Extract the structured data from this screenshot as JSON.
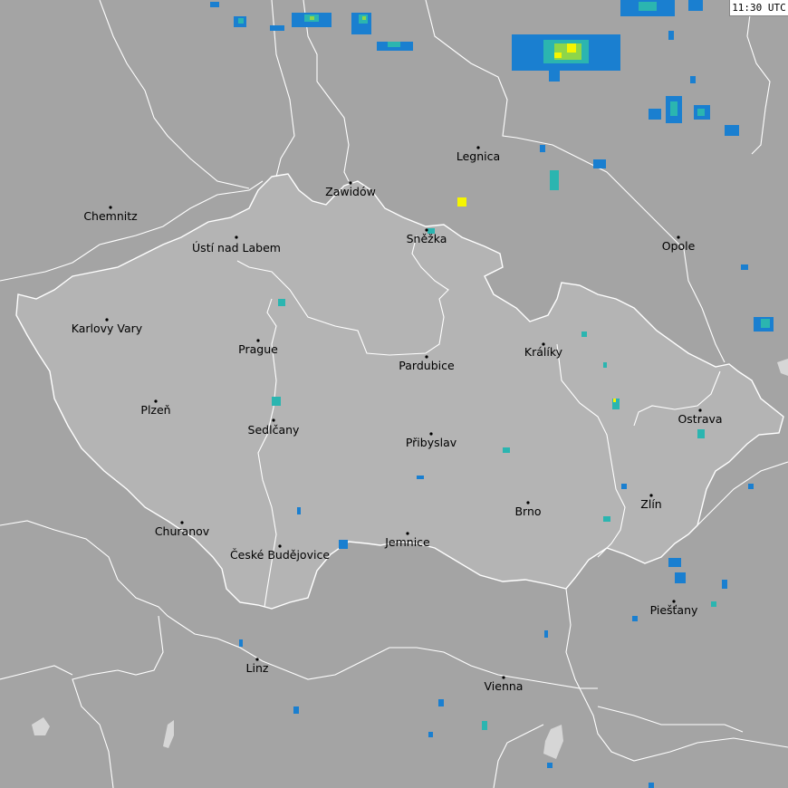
{
  "timestamp": "11:30 UTC",
  "colors": {
    "background": "#a4a4a4",
    "czech_republic": "#b4b4b4",
    "border": "#ffffff",
    "water": "#d6d6d6",
    "radar_low": "#1a7fd0",
    "radar_mid": "#2bb5b0",
    "radar_green": "#8ed649",
    "radar_high": "#f5f500"
  },
  "cities": [
    {
      "key": "chemnitz",
      "name": "Chemnitz"
    },
    {
      "key": "usti",
      "name": "Ústí nad Labem"
    },
    {
      "key": "karlovy-vary",
      "name": "Karlovy Vary"
    },
    {
      "key": "prague",
      "name": "Prague"
    },
    {
      "key": "plzen",
      "name": "Plzeň"
    },
    {
      "key": "sedlcany",
      "name": "Sedlčany"
    },
    {
      "key": "churanov",
      "name": "Churanov"
    },
    {
      "key": "ceske-budejovice",
      "name": "České Budějovice"
    },
    {
      "key": "zawidow",
      "name": "Zawidów"
    },
    {
      "key": "legnica",
      "name": "Legnica"
    },
    {
      "key": "snezka",
      "name": "Sněžka"
    },
    {
      "key": "pardubice",
      "name": "Pardubice"
    },
    {
      "key": "kraliky",
      "name": "Králíky"
    },
    {
      "key": "opole",
      "name": "Opole"
    },
    {
      "key": "ostrava",
      "name": "Ostrava"
    },
    {
      "key": "pribyslav",
      "name": "Přibyslav"
    },
    {
      "key": "brno",
      "name": "Brno"
    },
    {
      "key": "zlin",
      "name": "Zlín"
    },
    {
      "key": "jemnice",
      "name": "Jemnice"
    },
    {
      "key": "piestany",
      "name": "Piešťany"
    },
    {
      "key": "linz",
      "name": "Linz"
    },
    {
      "key": "vienna",
      "name": "Vienna"
    }
  ]
}
